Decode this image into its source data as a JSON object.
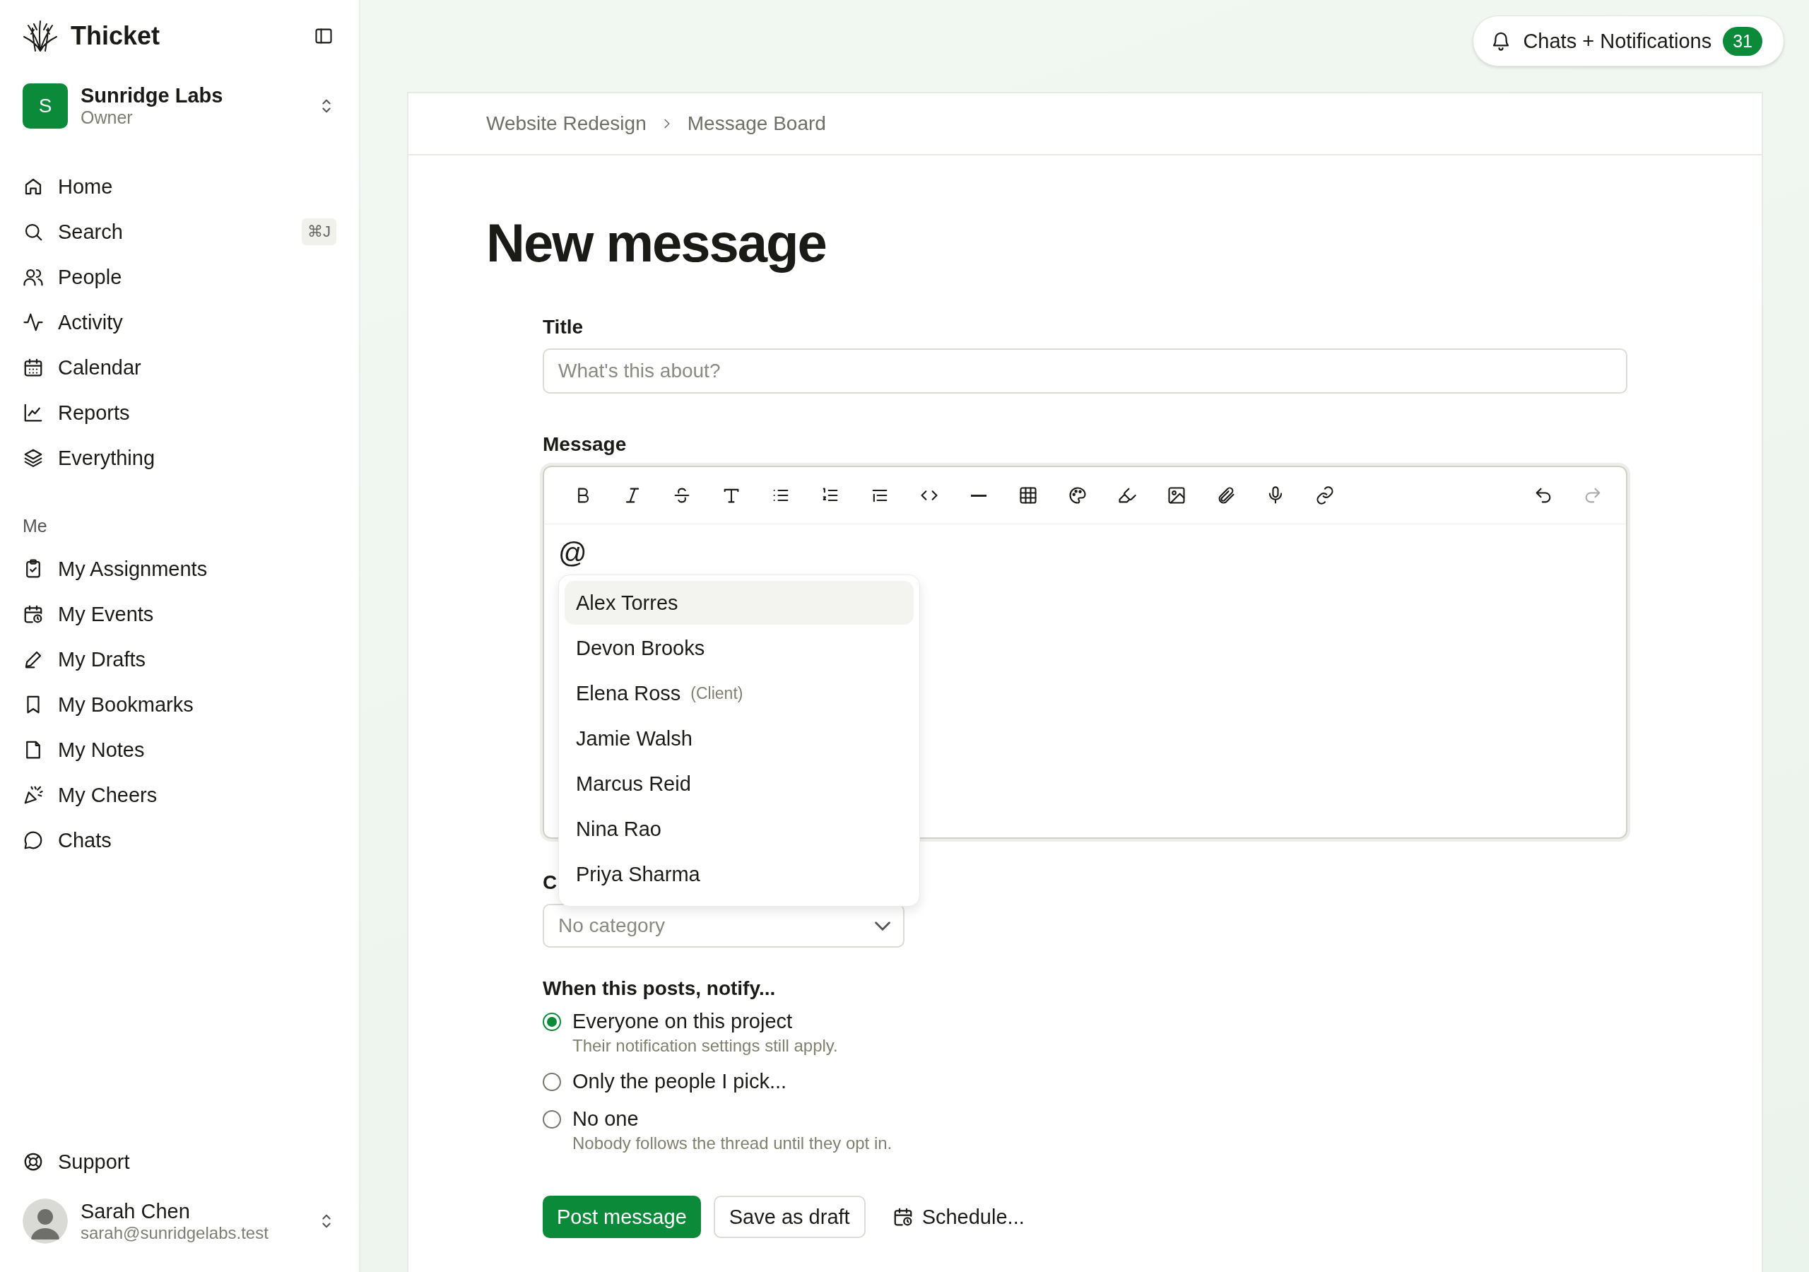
{
  "app": {
    "name": "Thicket"
  },
  "workspace": {
    "initial": "S",
    "name": "Sunridge Labs",
    "role": "Owner"
  },
  "nav": [
    {
      "label": "Home"
    },
    {
      "label": "Search",
      "shortcut": "⌘J"
    },
    {
      "label": "People"
    },
    {
      "label": "Activity"
    },
    {
      "label": "Calendar"
    },
    {
      "label": "Reports"
    },
    {
      "label": "Everything"
    }
  ],
  "me_section": {
    "heading": "Me",
    "items": [
      {
        "label": "My Assignments"
      },
      {
        "label": "My Events"
      },
      {
        "label": "My Drafts"
      },
      {
        "label": "My Bookmarks"
      },
      {
        "label": "My Notes"
      },
      {
        "label": "My Cheers"
      },
      {
        "label": "Chats"
      }
    ]
  },
  "support": {
    "label": "Support"
  },
  "user": {
    "name": "Sarah Chen",
    "email": "sarah@sunridgelabs.test"
  },
  "notifications": {
    "label": "Chats + Notifications",
    "count": "31"
  },
  "breadcrumb": [
    "Website Redesign",
    "Message Board"
  ],
  "page_title": "New message",
  "form": {
    "title_field": {
      "label": "Title",
      "placeholder": "What's this about?"
    },
    "message": {
      "label": "Message",
      "undo": {
        "disabled": false
      },
      "redo": {
        "disabled": true
      },
      "value": "@",
      "mentions": [
        {
          "name": "Alex Torres",
          "selected": true
        },
        {
          "name": "Devon Brooks",
          "selected": false
        },
        {
          "name": "Elena Ross",
          "note": "(Client)",
          "selected": false
        },
        {
          "name": "Jamie Walsh",
          "selected": false
        },
        {
          "name": "Marcus Reid",
          "selected": false
        },
        {
          "name": "Nina Rao",
          "selected": false
        },
        {
          "name": "Priya Sharma",
          "selected": false
        }
      ]
    },
    "category": {
      "label": "C",
      "placeholder": "No category"
    },
    "notify": {
      "heading": "When this posts, notify...",
      "options": [
        {
          "label": "Everyone on this project",
          "hint": "Their notification settings still apply.",
          "selected": true
        },
        {
          "label": "Only the people I pick...",
          "selected": false
        },
        {
          "label": "No one",
          "hint": "Nobody follows the thread until they opt in.",
          "selected": false
        }
      ]
    },
    "actions": {
      "post": "Post message",
      "draft": "Save as draft",
      "schedule": "Schedule..."
    }
  }
}
